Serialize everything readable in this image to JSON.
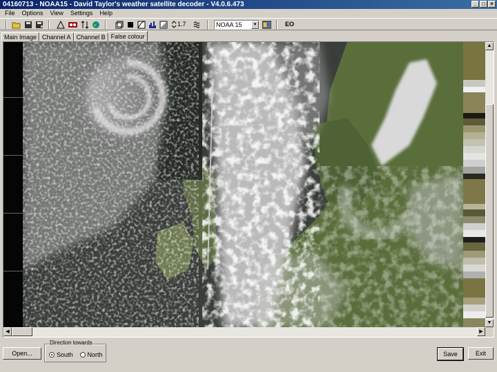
{
  "window": {
    "title": "04160713 - NOAA15 - David Taylor's weather satellite decoder - V4.0.6.473",
    "minimize_glyph": "_",
    "maximize_glyph": "□",
    "close_glyph": "×"
  },
  "menu": [
    "File",
    "Options",
    "View",
    "Settings",
    "Help"
  ],
  "toolbar": {
    "gamma_value": "1.7",
    "satellite": "NOAA 15",
    "eo_label": "EO",
    "icons": [
      "open-folder-icon",
      "save-icon",
      "save-as-icon",
      "calibrate-icon",
      "tape-icon",
      "swap-icon",
      "globe-icon",
      "channel-icon",
      "black-square-icon",
      "enhance-icon",
      "histogram-icon",
      "contrast-icon",
      "gamma-spinner-icon",
      "noise-icon",
      "palette-icon"
    ]
  },
  "tabs": [
    "Main Image",
    "Channel A",
    "Channel B",
    "False colour"
  ],
  "active_tab": "False colour",
  "direction": {
    "legend": "Direction towards",
    "options": [
      "South",
      "North"
    ],
    "selected": "South"
  },
  "buttons": {
    "open": "Open...",
    "save": "Save",
    "exit": "Exit"
  },
  "colors": {
    "title_start": "#0a246a",
    "title_end": "#3a6ea5",
    "chrome": "#d4d0c8"
  }
}
